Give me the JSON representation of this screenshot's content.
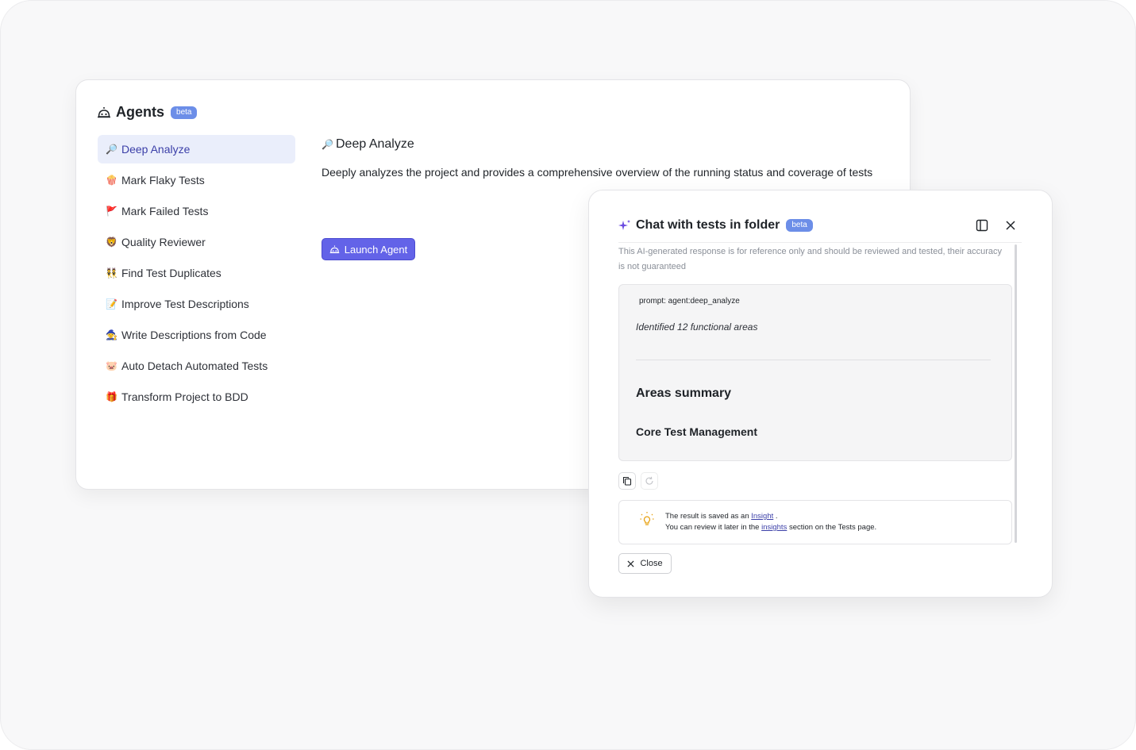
{
  "agents": {
    "title": "Agents",
    "badge": "beta",
    "items": [
      {
        "icon": "🔎",
        "label": "Deep Analyze",
        "active": true
      },
      {
        "icon": "🍿",
        "label": "Mark Flaky Tests"
      },
      {
        "icon": "🚩",
        "label": "Mark Failed Tests"
      },
      {
        "icon": "🦁",
        "label": "Quality Reviewer"
      },
      {
        "icon": "👯",
        "label": "Find Test Duplicates"
      },
      {
        "icon": "📝",
        "label": "Improve Test Descriptions"
      },
      {
        "icon": "🧙",
        "label": "Write Descriptions from Code"
      },
      {
        "icon": "🐷",
        "label": "Auto Detach Automated Tests"
      },
      {
        "icon": "🎁",
        "label": "Transform Project to BDD"
      }
    ],
    "detail": {
      "icon": "🔎",
      "title": "Deep Analyze",
      "description": "Deeply analyzes the project and provides a comprehensive overview of the running status and coverage of tests",
      "launch_label": "Launch Agent"
    }
  },
  "chat": {
    "title": "Chat with tests in folder",
    "badge": "beta",
    "disclaimer": "This AI-generated response is for reference only and should be reviewed and tested, their accuracy is not guaranteed",
    "prompt": "prompt: agent:deep_analyze",
    "identified": "Identified 12 functional areas",
    "areas_title": "Areas summary",
    "core_title": "Core Test Management",
    "info_line1_pre": "The result is saved as an ",
    "info_line1_link": "Insight",
    "info_line1_post": " .",
    "info_line2_pre": "You can review it later in the ",
    "info_line2_link": "insights",
    "info_line2_post": " section on the Tests page.",
    "close_label": "Close"
  },
  "colors": {
    "accent": "#6363e8",
    "badge": "#6c8ee8",
    "active_bg": "#eaeefb",
    "bulb": "#e8a317"
  }
}
